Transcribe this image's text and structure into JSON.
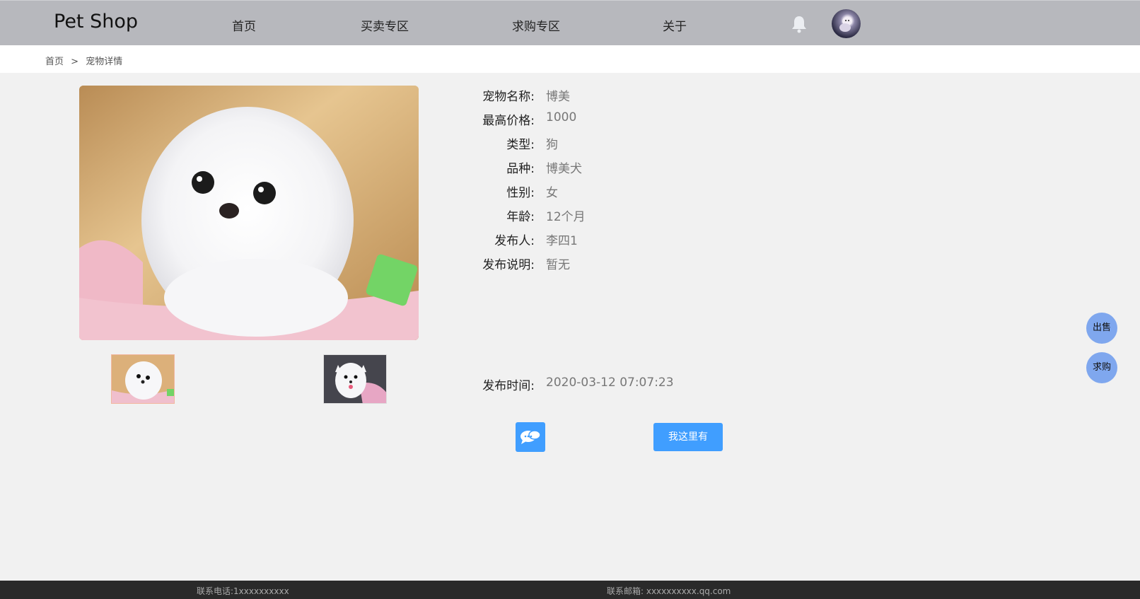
{
  "header": {
    "brand": "Pet Shop",
    "nav": [
      {
        "label": "首页"
      },
      {
        "label": "买卖专区"
      },
      {
        "label": "求购专区"
      },
      {
        "label": "关于"
      }
    ],
    "icons": {
      "notification": "bell-icon",
      "user": "avatar"
    }
  },
  "breadcrumb": {
    "home": "首页",
    "separator": ">",
    "current": "宠物详情"
  },
  "pet": {
    "fields": [
      {
        "label": "宠物名称:",
        "value": "博美"
      },
      {
        "label": "最高价格:",
        "value": "1000"
      },
      {
        "label": "类型:",
        "value": "狗"
      },
      {
        "label": "品种:",
        "value": "博美犬"
      },
      {
        "label": "性别:",
        "value": "女"
      },
      {
        "label": "年龄:",
        "value": "12个月"
      },
      {
        "label": "发布人:",
        "value": "李四1"
      },
      {
        "label": "发布说明:",
        "value": "暂无"
      }
    ],
    "publish_time_label": "发布时间:",
    "publish_time": "2020-03-12 07:07:23"
  },
  "actions": {
    "chat_icon": "chat-bubble-icon",
    "have_it": "我这里有"
  },
  "float_actions": {
    "sell": "出售",
    "buy": "求购"
  },
  "footer": {
    "phone": "联系电话:1xxxxxxxxxx",
    "email": "联系邮箱: xxxxxxxxxx.qq.com"
  },
  "colors": {
    "header_bg": "#b7b8bd",
    "primary": "#409eff",
    "float_btn": "#7fa7ee",
    "footer_bg": "#2a2a2a"
  }
}
